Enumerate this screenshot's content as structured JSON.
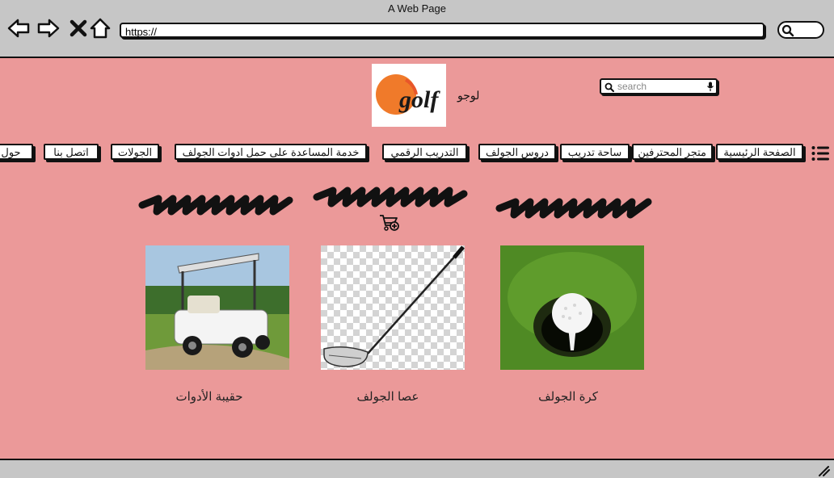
{
  "window": {
    "title": "A Web Page"
  },
  "browser": {
    "url": "https://"
  },
  "header": {
    "logo_text": "golf",
    "logo_label": "لوجو",
    "search_placeholder": "search"
  },
  "nav": {
    "items": [
      {
        "label": "الصفحة الرئيسية"
      },
      {
        "label": "متجر المحترفين"
      },
      {
        "label": "ساحة تدريب"
      },
      {
        "label": "دروس الجولف"
      },
      {
        "label": "التدريب الرقمي"
      },
      {
        "label": "خدمة المساعدة على حمل ادوات الجولف"
      },
      {
        "label": "الجولات"
      },
      {
        "label": "اتصل بنا"
      },
      {
        "label": "حول"
      }
    ]
  },
  "products": [
    {
      "label": "حقيبة الأدوات"
    },
    {
      "label": "عصا الجولف"
    },
    {
      "label": "كرة الجولف"
    }
  ],
  "colors": {
    "content_bg": "#eb9999",
    "chrome_bg": "#c6c6c6",
    "logo_orange": "#f07a2a"
  }
}
